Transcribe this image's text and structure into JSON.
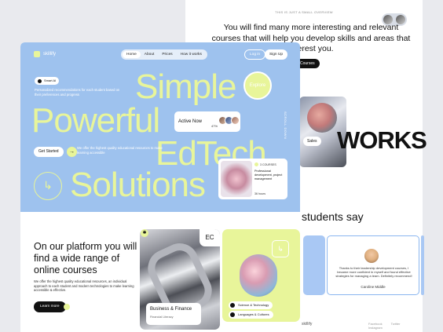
{
  "back_page": {
    "overview_label": "THIS IS JUST A SMALL OVERVIEW",
    "headline": "You will find many more interesting and relevant courses that will help you develop skills and areas that interest you.",
    "courses_button": "Courses",
    "sales_chip": "Sales",
    "works_heading": "WORKS",
    "students_heading": "students say",
    "testimonial_quote": "Thanks to their leadership development courses, I became more confident in myself and found effective strategies for managing a team. Definitely recommend!",
    "testimonial_author": "Caroline Middle",
    "footer_logo": "skillify",
    "footer_links": [
      "Facebook",
      "Twitter",
      "Instagram"
    ]
  },
  "header": {
    "logo": "skillify",
    "nav": [
      "Home",
      "About",
      "Prices",
      "How it works"
    ],
    "login": "Log in",
    "signup": "Sign Up"
  },
  "hero": {
    "mini_chip": "Smart AI",
    "lede": "Personalized recommendations for each student based on their preferences and progress",
    "line1": "Simple",
    "line2": "Powerful",
    "line3": "EdTech",
    "line4": "Solutions",
    "explore": "Explore",
    "active_now": "Active Now",
    "active_pct": "47%",
    "vertical_label": "SCROLL DOWN",
    "get_started": "Get Started",
    "get_started_arrow": "→",
    "gs_text": "We offer the highest quality educational resources to make learning accessible",
    "circle_arrow": "↳",
    "course_card": {
      "tag": "3 COURSES",
      "desc": "Professional development, project management",
      "hours": "36 hours"
    }
  },
  "platform": {
    "title": "On our platform you will find a wide range of online courses",
    "text": "We offer the highest quality educational resources, an individual approach to each student and modern technologies to make learning accessible & effective.",
    "learn_more": "Learn more",
    "ec_label": "EC",
    "bf_title": "Business & Finance",
    "bf_sub": "Financial Literacy",
    "arrow": "↳",
    "pill1": "Science & Technology",
    "pill2": "Languages & Cultures"
  },
  "colors": {
    "hero_blue": "#9ec2ee",
    "accent_lime": "#e8f59a"
  }
}
